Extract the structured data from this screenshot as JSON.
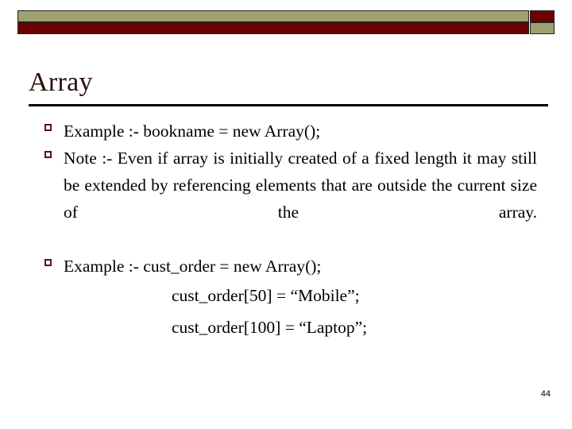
{
  "slide": {
    "title": "Array",
    "page_number": "44",
    "colors": {
      "banner_olive": "#9f9f6f",
      "banner_maroon": "#6d0000",
      "banner_border": "#231f20",
      "title_text": "#2b0b0b",
      "bullet_mark": "#5b1515",
      "body_text": "#000000",
      "rule": "#000000",
      "background": "#ffffff"
    },
    "banner": {
      "top_long_fill": "#9f9f6f",
      "top_square_fill": "#6d0000",
      "bottom_long_fill": "#6d0000",
      "bottom_square_fill": "#9f9f6f"
    }
  },
  "bullets": [
    {
      "marker": "hollow-square-bullet",
      "text": "Example :- bookname = new Array();",
      "justified": false
    },
    {
      "marker": "hollow-square-bullet",
      "text": "Note :- Even if array is initially created of a fixed length it may still be extended by referencing elements that are outside the current size of the array.",
      "justified": true
    },
    {
      "marker": "hollow-square-bullet",
      "text": "Example :-  cust_order = new Array();",
      "justified": false
    }
  ],
  "code_lines": [
    "cust_order[50] = “Mobile”;",
    "cust_order[100] = “Laptop”;"
  ]
}
